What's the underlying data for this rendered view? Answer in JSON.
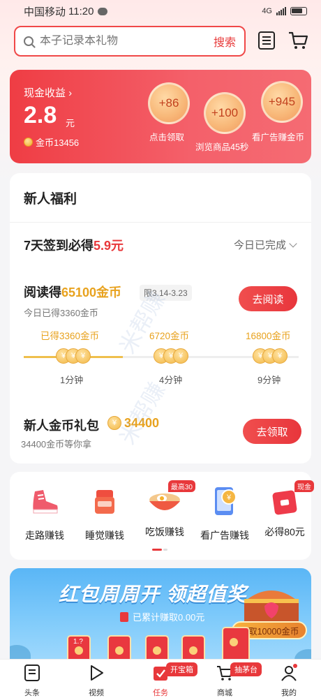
{
  "status_bar": {
    "carrier": "中国移动",
    "time": "11:20",
    "network": "4G"
  },
  "search": {
    "placeholder": "本子记录本礼物",
    "button": "搜索"
  },
  "cash": {
    "label": "现金收益",
    "value": "2.8",
    "unit": "元",
    "coins": "金币13456",
    "bubbles": [
      {
        "amount": "+86",
        "caption": "点击领取"
      },
      {
        "amount": "+100",
        "caption": "浏览商品45秒"
      },
      {
        "amount": "+945",
        "caption": "看广告赚金币"
      }
    ]
  },
  "welfare": {
    "title": "新人福利",
    "signin": {
      "text": "7天签到必得",
      "amount": "5.9元",
      "status": "今日已完成"
    },
    "reading": {
      "title": "阅读得",
      "amount": "65100金币",
      "limit": "限3.14-3.23",
      "sub": "今日已得3360金币",
      "button": "去阅读",
      "progress_fraction": 0.36,
      "milestones": [
        {
          "coins": "已得3360金币",
          "time": "1分钟"
        },
        {
          "coins": "6720金币",
          "time": "4分钟"
        },
        {
          "coins": "16800金币",
          "time": "9分钟"
        }
      ]
    },
    "gift": {
      "title": "新人金币礼包",
      "amount": "34400",
      "sub": "34400金币等你拿",
      "button": "去领取"
    }
  },
  "watermark": "米帮赚",
  "earn": [
    {
      "label": "走路赚钱",
      "icon": "sneaker-icon",
      "badge": ""
    },
    {
      "label": "睡觉赚钱",
      "icon": "cup-icon",
      "badge": ""
    },
    {
      "label": "吃饭赚钱",
      "icon": "noodle-bowl-icon",
      "badge": "最高30"
    },
    {
      "label": "看广告赚钱",
      "icon": "phone-coin-icon",
      "badge": ""
    },
    {
      "label": "必得80元",
      "icon": "red-packet-icon",
      "badge": "现金"
    }
  ],
  "banner": {
    "title": "红包周周开 领超值奖",
    "sub": "已累计赚取0.00元",
    "chest_button": "领取10000金币",
    "envelope_label": "1.?"
  },
  "tabs": [
    {
      "label": "头条",
      "icon": "headline-icon",
      "tag": ""
    },
    {
      "label": "视频",
      "icon": "play-icon",
      "tag": ""
    },
    {
      "label": "任务",
      "icon": "task-icon",
      "tag": "开宝箱"
    },
    {
      "label": "商城",
      "icon": "cart-icon",
      "tag": "抽茅台"
    },
    {
      "label": "我的",
      "icon": "user-icon",
      "tag": ""
    }
  ],
  "colors": {
    "brand_red": "#e8383b",
    "gold": "#e8a21e"
  }
}
